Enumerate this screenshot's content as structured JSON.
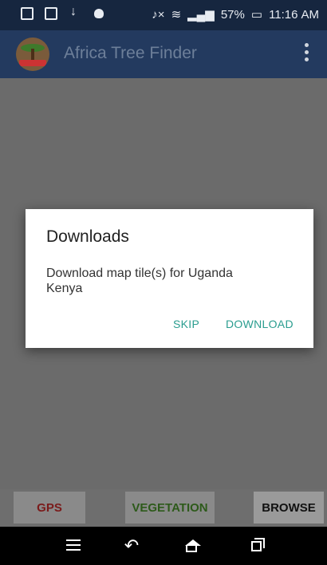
{
  "status_bar": {
    "battery": "57%",
    "time": "11:16",
    "ampm": "AM"
  },
  "app_bar": {
    "title": "Africa Tree Finder",
    "logo_icon": "world-agroforestry-logo"
  },
  "dialog": {
    "title": "Downloads",
    "message": "Download map tile(s) for  Uganda\nKenya",
    "skip_label": "SKIP",
    "download_label": "DOWNLOAD",
    "accent_color": "#2a9d8f"
  },
  "toolbar": {
    "gps_label": "GPS",
    "vegetation_label": "VEGETATION",
    "browse_label": "BROWSE"
  },
  "colors": {
    "status_bar": "#16263f",
    "app_bar": "#233a5f",
    "map_background": "#6b6b6b"
  }
}
